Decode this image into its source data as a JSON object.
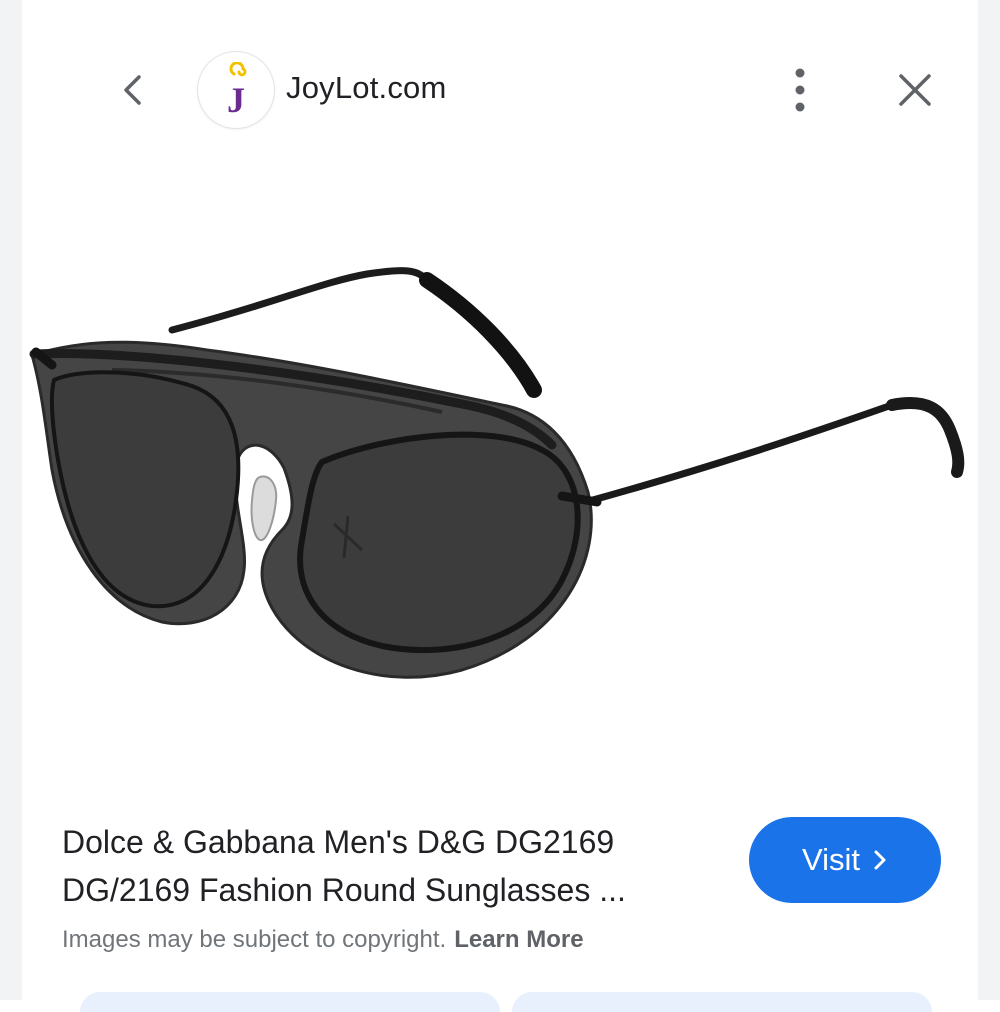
{
  "header": {
    "site_name": "JoyLot.com",
    "logo_letter": "J",
    "icons": {
      "back": "chevron-left-icon",
      "more": "more-vertical-icon",
      "close": "close-icon"
    }
  },
  "result": {
    "title_line1": "Dolce & Gabbana Men's D&G DG2169",
    "title_line2": "DG/2169 Fashion Round Sunglasses ...",
    "visit_label": "Visit",
    "copyright_text": "Images may be subject to copyright.",
    "learn_more": "Learn More"
  },
  "colors": {
    "accent": "#1a73e8",
    "logo_purple": "#6a2c91",
    "logo_yellow": "#f2c200"
  }
}
